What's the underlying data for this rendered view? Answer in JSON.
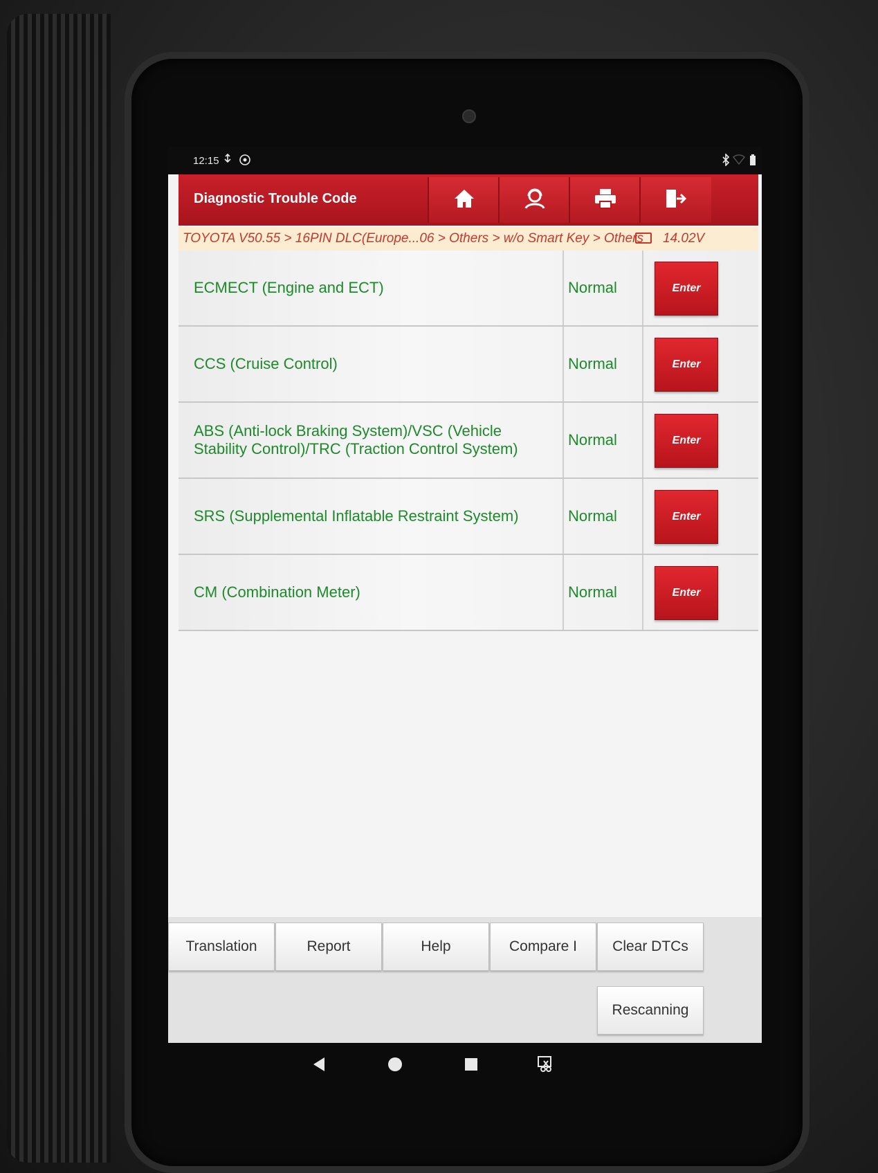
{
  "status_bar": {
    "time": "12:15",
    "left_icons": [
      "usb-icon",
      "settings-icon"
    ],
    "right_icons": [
      "bluetooth-icon",
      "wifi-icon",
      "battery-icon"
    ]
  },
  "header": {
    "title": "Diagnostic Trouble Code",
    "buttons": [
      "home-icon",
      "support-icon",
      "print-icon",
      "exit-icon"
    ]
  },
  "breadcrumb": {
    "path": "TOYOTA V50.55 > 16PIN DLC(Europe...06 > Others > w/o Smart Key > Others",
    "voltage": "14.02V"
  },
  "systems": [
    {
      "name": "ECMECT (Engine and ECT)",
      "status": "Normal",
      "action": "Enter"
    },
    {
      "name": "CCS (Cruise Control)",
      "status": "Normal",
      "action": "Enter"
    },
    {
      "name": "ABS (Anti-lock Braking System)/VSC (Vehicle Stability Control)/TRC (Traction Control System)",
      "status": "Normal",
      "action": "Enter"
    },
    {
      "name": "SRS (Supplemental Inflatable Restraint System)",
      "status": "Normal",
      "action": "Enter"
    },
    {
      "name": "CM (Combination Meter)",
      "status": "Normal",
      "action": "Enter"
    }
  ],
  "footer": {
    "translation": "Translation",
    "report": "Report",
    "help": "Help",
    "compare": "Compare I",
    "clear_dtcs": "Clear DTCs",
    "rescanning": "Rescanning"
  },
  "nav_bar": {
    "icons": [
      "back-icon",
      "home-circle-icon",
      "recents-icon",
      "screenshot-icon"
    ]
  },
  "colors": {
    "accent_red": "#c8202a",
    "status_green": "#1d8a2a",
    "breadcrumb_text": "#c33a2c"
  }
}
